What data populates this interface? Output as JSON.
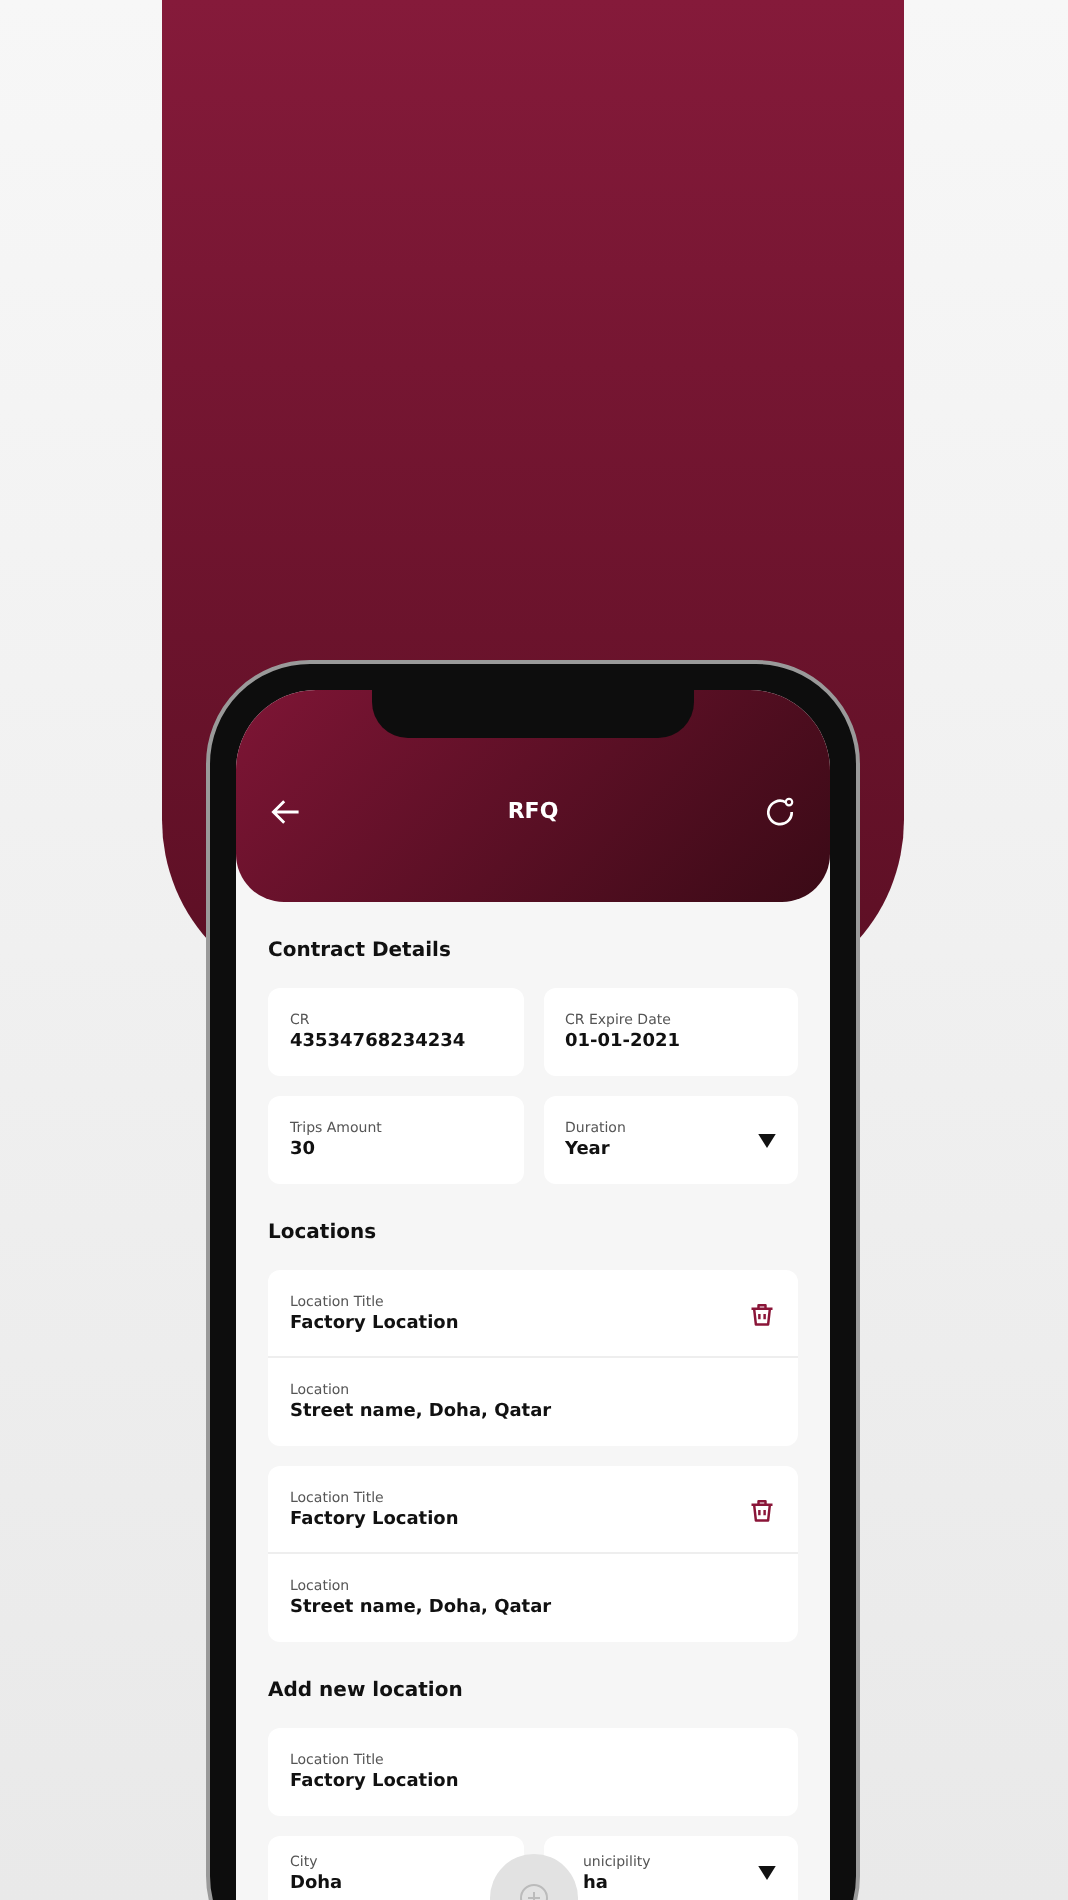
{
  "header": {
    "title": "RFQ"
  },
  "contract": {
    "heading": "Contract Details",
    "fields": [
      {
        "label": "CR",
        "value": "43534768234234",
        "kind": "text"
      },
      {
        "label": "CR Expire Date",
        "value": "01-01-2021",
        "kind": "text"
      },
      {
        "label": "Trips Amount",
        "value": "30",
        "kind": "text"
      },
      {
        "label": "Duration",
        "value": "Year",
        "kind": "dropdown"
      }
    ]
  },
  "locations": {
    "heading": "Locations",
    "items": [
      {
        "title_label": "Location Title",
        "title": "Factory Location",
        "location_label": "Location",
        "location": "Street name, Doha, Qatar"
      },
      {
        "title_label": "Location Title",
        "title": "Factory Location",
        "location_label": "Location",
        "location": "Street name, Doha, Qatar"
      }
    ]
  },
  "new_location": {
    "heading": "Add new location",
    "title_field": {
      "label": "Location Title",
      "value": "Factory Location"
    },
    "fields": [
      {
        "label": "City",
        "value": "Doha",
        "kind": "text"
      },
      {
        "label": "unicipility",
        "value": "ha",
        "kind": "dropdown"
      }
    ]
  }
}
